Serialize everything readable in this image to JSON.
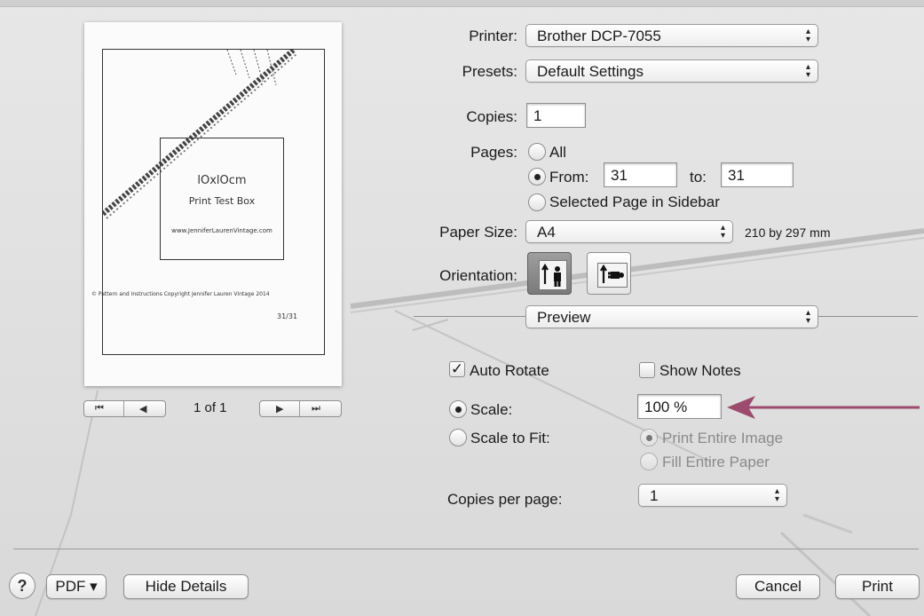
{
  "preview": {
    "box_title": "lOxlOcm",
    "box_subtitle": "Print Test Box",
    "box_url": "www.JenniferLaurenVintage.com",
    "copyright": "© Pattern and Instructions Copyright Jennifer Lauren Vintage 2014",
    "page_number": "31/31",
    "nav_first": "⏮",
    "nav_prev": "◀",
    "page_indicator": "1 of 1",
    "nav_next": "▶",
    "nav_last": "⏭"
  },
  "printer": {
    "label": "Printer:",
    "value": "Brother DCP-7055"
  },
  "presets": {
    "label": "Presets:",
    "value": "Default Settings"
  },
  "copies": {
    "label": "Copies:",
    "value": "1"
  },
  "pages": {
    "label": "Pages:",
    "all_label": "All",
    "from_label": "From:",
    "from_value": "31",
    "to_label": "to:",
    "to_value": "31",
    "selected_label": "Selected Page in Sidebar"
  },
  "paper_size": {
    "label": "Paper Size:",
    "value": "A4",
    "dimensions": "210 by 297 mm"
  },
  "orientation": {
    "label": "Orientation:"
  },
  "section_popup": {
    "value": "Preview"
  },
  "preview_options": {
    "auto_rotate_label": "Auto Rotate",
    "show_notes_label": "Show Notes",
    "scale_label": "Scale:",
    "scale_value": "100 %",
    "scale_to_fit_label": "Scale to Fit:",
    "print_entire_image_label": "Print Entire Image",
    "fill_entire_paper_label": "Fill Entire Paper",
    "copies_per_page_label": "Copies per page:",
    "copies_per_page_value": "1"
  },
  "footer": {
    "help_label": "?",
    "pdf_label": "PDF ▾",
    "hide_details_label": "Hide Details",
    "cancel_label": "Cancel",
    "print_label": "Print"
  },
  "colors": {
    "annotation_arrow": "#9c4b6e"
  }
}
